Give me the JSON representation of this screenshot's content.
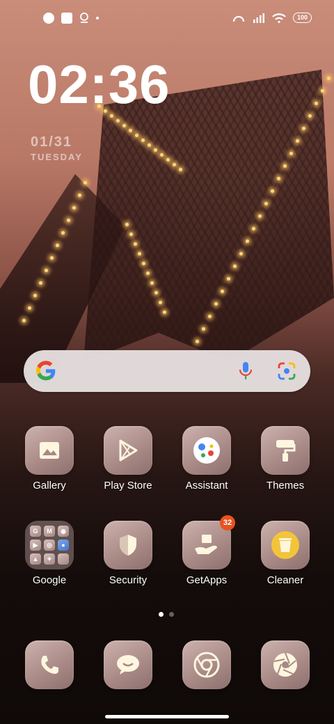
{
  "status_bar": {
    "left_icons": [
      "app-notification-icon",
      "square-notification-icon",
      "location-icon",
      "dot-icon"
    ],
    "right_icons": [
      "hotspot-icon",
      "signal-icon",
      "wifi-icon"
    ],
    "battery": "100"
  },
  "lockscreen": {
    "time": "02:36",
    "date": "01/31",
    "weekday": "TUESDAY"
  },
  "search_bar": {
    "logo": "google-g-icon",
    "mic": "microphone-icon",
    "lens": "google-lens-icon"
  },
  "apps": [
    {
      "label": "Gallery",
      "icon": "gallery-icon"
    },
    {
      "label": "Play Store",
      "icon": "play-store-icon"
    },
    {
      "label": "Assistant",
      "icon": "assistant-icon"
    },
    {
      "label": "Themes",
      "icon": "paint-roller-icon"
    },
    {
      "label": "Google",
      "icon": "folder-icon",
      "folder_items": [
        "G",
        "M",
        "",
        "",
        "",
        "",
        "",
        "",
        ""
      ]
    },
    {
      "label": "Security",
      "icon": "shield-icon"
    },
    {
      "label": "GetApps",
      "icon": "getapps-icon",
      "badge": "32"
    },
    {
      "label": "Cleaner",
      "icon": "trash-icon"
    }
  ],
  "dock": [
    {
      "icon": "phone-icon"
    },
    {
      "icon": "message-icon"
    },
    {
      "icon": "chrome-icon"
    },
    {
      "icon": "camera-aperture-icon"
    }
  ],
  "page_indicator": {
    "pages": 2,
    "active": 1
  },
  "colors": {
    "badge": "#e8531f",
    "accent_yellow": "#f3c43a"
  }
}
